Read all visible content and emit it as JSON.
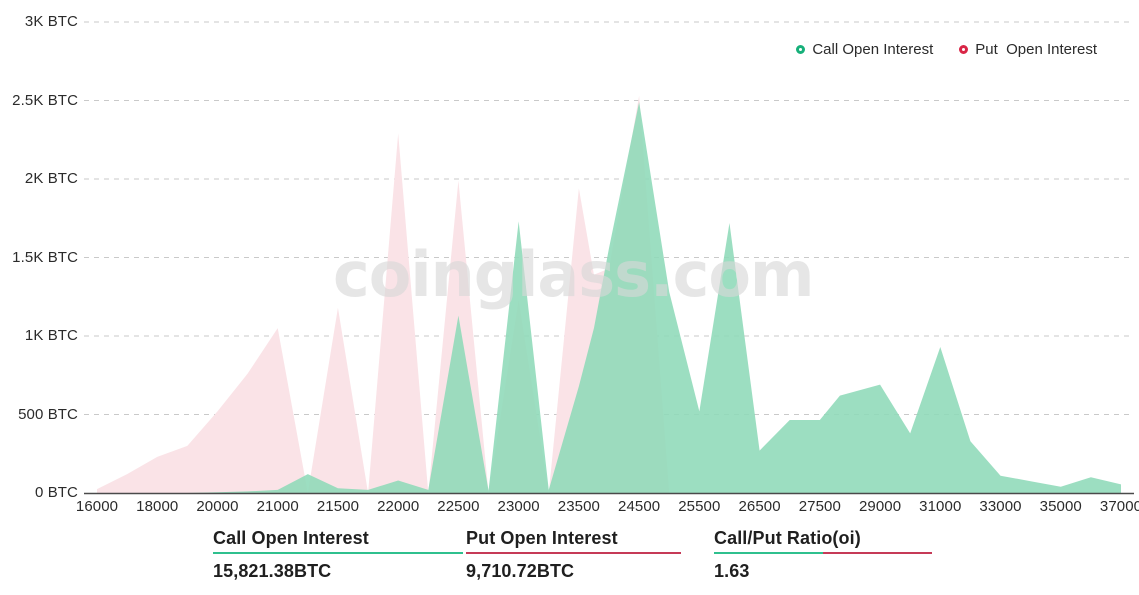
{
  "legend": {
    "items": [
      {
        "label": "Call Open Interest",
        "color": "#17b07a",
        "key": "call"
      },
      {
        "label": "Put  Open Interest",
        "color": "#d92546",
        "key": "put"
      }
    ]
  },
  "watermark": "coinglass.com",
  "summary": {
    "items": [
      {
        "title": "Call Open Interest",
        "value": "15,821.38BTC",
        "rule": "call"
      },
      {
        "title": "Put Open Interest",
        "value": "9,710.72BTC",
        "rule": "put"
      },
      {
        "title": "Call/Put Ratio(oi)",
        "value": "1.63",
        "rule": "split"
      }
    ]
  },
  "chart_data": {
    "type": "area",
    "title": "",
    "xlabel": "",
    "ylabel": "",
    "ylim": [
      0,
      3000
    ],
    "yunit": "BTC",
    "grid": true,
    "legend_position": "top-right",
    "ytick_labels": [
      "3K BTC",
      "2.5K BTC",
      "2K BTC",
      "1.5K BTC",
      "1K BTC",
      "500 BTC",
      "0 BTC"
    ],
    "ytick_values": [
      3000,
      2500,
      2000,
      1500,
      1000,
      500,
      0
    ],
    "xtick_labels": [
      "16000",
      "18000",
      "20000",
      "21000",
      "21500",
      "22000",
      "22500",
      "23000",
      "23500",
      "24500",
      "25500",
      "26500",
      "27500",
      "29000",
      "31000",
      "33000",
      "35000",
      "37000"
    ],
    "strikes": [
      16000,
      17000,
      18000,
      19000,
      20000,
      20500,
      21000,
      21250,
      21500,
      21750,
      22000,
      22250,
      22500,
      22750,
      23000,
      23250,
      23500,
      23750,
      24000,
      24500,
      25000,
      25500,
      26000,
      26500,
      27000,
      27500,
      28000,
      29000,
      30000,
      31000,
      32000,
      33000,
      34000,
      35000,
      36000,
      37000,
      38000
    ],
    "series": [
      {
        "name": "Call Open Interest",
        "color": "#8ed9b8",
        "values": [
          0,
          0,
          0,
          0,
          5,
          10,
          20,
          120,
          30,
          20,
          80,
          20,
          1130,
          15,
          1730,
          20,
          680,
          1050,
          1560,
          2490,
          1280,
          520,
          1720,
          270,
          465,
          465,
          620,
          690,
          380,
          930,
          330,
          110,
          75,
          40,
          100,
          55,
          0
        ]
      },
      {
        "name": "Put  Open Interest",
        "color": "#fae3e7",
        "values": [
          25,
          120,
          230,
          300,
          520,
          760,
          1050,
          0,
          1180,
          0,
          2290,
          0,
          1990,
          0,
          1230,
          0,
          1940,
          1390,
          1430,
          2530,
          0,
          0,
          0,
          0,
          0,
          0,
          0,
          0,
          0,
          0,
          0,
          0,
          0,
          0,
          0,
          0,
          0
        ]
      }
    ]
  }
}
